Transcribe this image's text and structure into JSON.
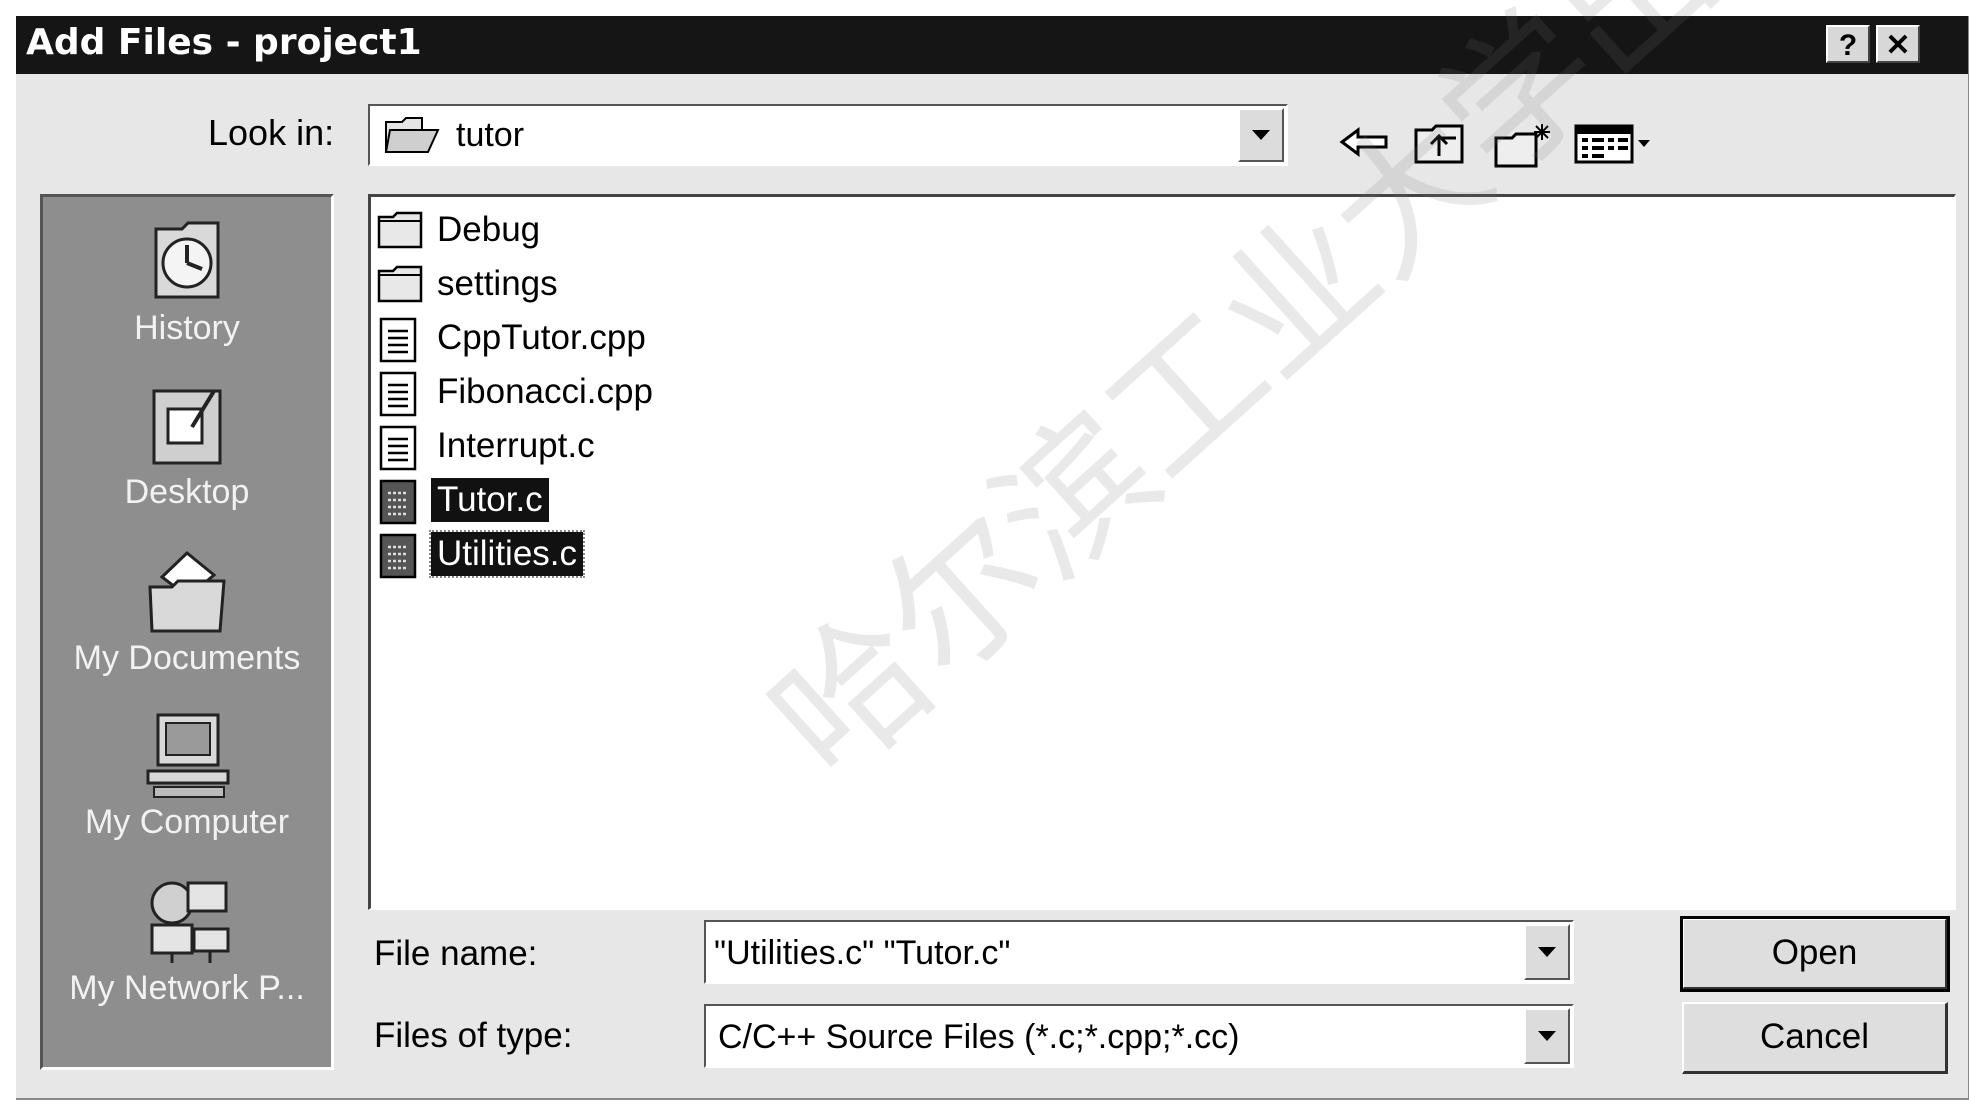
{
  "window": {
    "title": "Add Files - project1",
    "help_button": "?",
    "close_button": "✕"
  },
  "look_in": {
    "label": "Look in:",
    "value": "tutor"
  },
  "toolbar": {
    "icons": [
      "back-arrow-icon",
      "up-folder-icon",
      "new-folder-icon",
      "view-menu-icon"
    ]
  },
  "places": [
    {
      "label": "History",
      "icon": "history-icon"
    },
    {
      "label": "Desktop",
      "icon": "desktop-icon"
    },
    {
      "label": "My Documents",
      "icon": "my-documents-icon"
    },
    {
      "label": "My Computer",
      "icon": "my-computer-icon"
    },
    {
      "label": "My Network P...",
      "icon": "my-network-places-icon"
    }
  ],
  "files": [
    {
      "name": "Debug",
      "type": "folder",
      "selected": false
    },
    {
      "name": "settings",
      "type": "folder",
      "selected": false
    },
    {
      "name": "CppTutor.cpp",
      "type": "document",
      "selected": false
    },
    {
      "name": "Fibonacci.cpp",
      "type": "document",
      "selected": false
    },
    {
      "name": "Interrupt.c",
      "type": "document",
      "selected": false
    },
    {
      "name": "Tutor.c",
      "type": "document",
      "selected": true
    },
    {
      "name": "Utilities.c",
      "type": "document",
      "selected": true
    }
  ],
  "file_name": {
    "label": "File name:",
    "value": "\"Utilities.c\" \"Tutor.c\""
  },
  "file_type": {
    "label": "Files of type:",
    "value": "C/C++ Source Files (*.c;*.cpp;*.cc)"
  },
  "buttons": {
    "open": "Open",
    "cancel": "Cancel"
  },
  "watermark": "哈尔滨工业大学出版社",
  "colors": {
    "titlebar": "#151515",
    "dialog_bg": "#e7e7e7",
    "places_bg": "#8e8e8e",
    "selection": "#111111"
  }
}
